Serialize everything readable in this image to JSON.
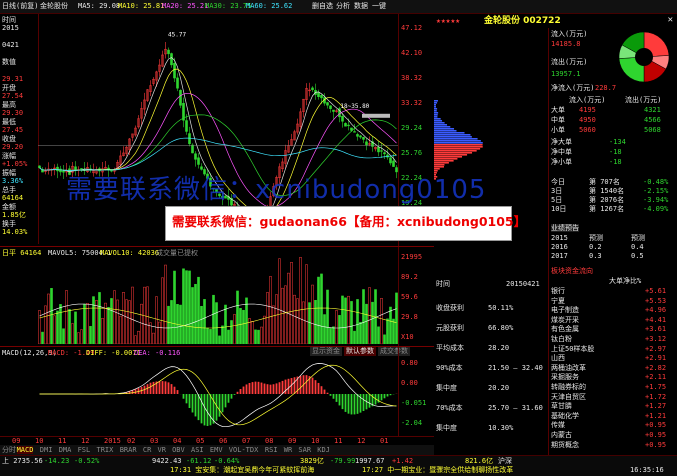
{
  "toolbar": {
    "period": "日线(前复)",
    "stock_name": "金轮股份",
    "ma5": "MA5: 29.08",
    "ma10": "MA10: 25.81",
    "ma20": "MA20: 25.21",
    "ma30": "MA30: 23.75",
    "ma60": "MA60: 25.62",
    "right_tabs": [
      "删自选",
      "分析",
      "数据",
      "一键"
    ]
  },
  "header": {
    "stars": "★★★★★",
    "title": "金轮股份 002722"
  },
  "left_info": [
    {
      "label": "时间",
      "value": "2015",
      "vc": "wht"
    },
    {
      "label": "",
      "value": "0421",
      "vc": "wht"
    },
    {
      "label": "",
      "value": "数值",
      "vc": "wht"
    },
    {
      "label": "",
      "value": "29.31",
      "vc": "red"
    },
    {
      "label": "开盘",
      "value": "27.54",
      "vc": "red"
    },
    {
      "label": "最高",
      "value": "29.30",
      "vc": "red"
    },
    {
      "label": "最低",
      "value": "27.45",
      "vc": "red"
    },
    {
      "label": "收盘",
      "value": "29.20",
      "vc": "red"
    },
    {
      "label": "涨幅",
      "value": "+1.05%",
      "vc": "red"
    },
    {
      "label": "振幅",
      "value": "3.36%",
      "vc": "cyn"
    },
    {
      "label": "总手",
      "value": "64164",
      "vc": "yel"
    },
    {
      "label": "金额",
      "value": "1.85亿",
      "vc": "yel"
    },
    {
      "label": "换手",
      "value": "14.03%",
      "vc": "yel"
    }
  ],
  "price_axis": [
    "47.12",
    "42.10",
    "38.32",
    "33.32",
    "29.24",
    "25.76",
    "22.24",
    "19.24",
    "16.12"
  ],
  "annotations": {
    "high": "45.77",
    "low": "16.12",
    "mid": "18~35.80"
  },
  "watermark_blue": "需要联系微信：xcnibudong0105",
  "banner": "需要联系微信：gudaonan66【备用：xcnibudong0105】",
  "volume": {
    "label": "日平 64164",
    "mavol5": "MAVOL5: 75004.1",
    "mavol10": "MAVOL10: 42036",
    "axis": [
      "21995",
      "89.2",
      "59.6",
      "29.8",
      "X10"
    ],
    "tab_label": "成交量已提权"
  },
  "macd": {
    "label": "MACD(12,26,9)",
    "value": "MACD: -1.49",
    "diff": "DIFF: -0.0071",
    "dea": "DEA: -0.116",
    "axis": [
      "0.80",
      "0.00",
      "-0.051",
      "-2.04"
    ],
    "buttons": [
      "显示资金",
      "默认参数",
      "成交参数"
    ]
  },
  "date_axis": [
    "09",
    "10",
    "11",
    "12",
    "2015",
    "02",
    "03",
    "04",
    "05",
    "06",
    "07",
    "08",
    "09",
    "10",
    "11",
    "12",
    "01"
  ],
  "bottom_tabs": [
    "分时",
    "MACD",
    "DMI",
    "DMA",
    "FSL",
    "TRIX",
    "BRAR",
    "CR",
    "VR",
    "OBV",
    "ASI",
    "EMV",
    "VOL-TDX",
    "RSI",
    "WR",
    "SAR",
    "KDJ"
  ],
  "index_strip": {
    "sh": "上 2735.56",
    "sh_chg": "-14.23",
    "sh_pct": "-0.52%",
    "sz": "9422.43",
    "sz_chg": "-61.12",
    "sz_pct": "-0.64%",
    "c3": "3829亿",
    "c4": "-79.99",
    "c5": "1997.67",
    "c6": "+1.42",
    "c7": "821.6亿",
    "market": "沪深",
    "news1": "17:31 宝安集：潮起宜吴鼎今年可紧蚊挥前海",
    "news2": "17:27 中一期宝业：暨骤宗全供给制聊扬性改革",
    "clock": "16:35:16"
  },
  "right_panel": {
    "inflow_label": "流入(万元)",
    "inflow_value": "14185.8",
    "outflow_label": "流出(万元)",
    "outflow_value": "13957.1",
    "net_label": "净流入(万元)",
    "net_value": "228.7",
    "pie_pcts": [
      "24%",
      "9%",
      "17%",
      "24%",
      "9%",
      "17%"
    ],
    "flow_table_headers": [
      "流入(万元)",
      "流出(万元)"
    ],
    "flow_rows": [
      {
        "label": "大单",
        "in": "4195",
        "out": "4321"
      },
      {
        "label": "中单",
        "in": "4950",
        "out": "4566"
      },
      {
        "label": "小单",
        "in": "5060",
        "out": "5068"
      }
    ],
    "net_rows": [
      {
        "label": "净大单",
        "v": "-134"
      },
      {
        "label": "净中单",
        "v": "-18"
      },
      {
        "label": "净小单",
        "v": "-18"
      }
    ],
    "rank_rows": [
      {
        "label": "今日",
        "rank": "第 707名",
        "pct": "-0.48%"
      },
      {
        "label": "3日",
        "rank": "第 1540名",
        "pct": "-2.15%"
      },
      {
        "label": "5日",
        "rank": "第 2076名",
        "pct": "-3.94%"
      },
      {
        "label": "10日",
        "rank": "第 1267名",
        "pct": "-4.09%"
      }
    ],
    "forecast_title": "业绩预告",
    "forecast_rows": [
      {
        "y": "2015",
        "v": "预测",
        "w": "预测"
      },
      {
        "y": "2016",
        "v": "0.2",
        "w": "0.4"
      },
      {
        "y": "2017",
        "v": "0.3",
        "w": "0.5"
      }
    ],
    "sector_title": "板块资金流向",
    "sector_header": "大单净比%",
    "sectors": [
      {
        "n": "银行",
        "v": "+5.61"
      },
      {
        "n": "宁夏",
        "v": "+5.53"
      },
      {
        "n": "电子制造",
        "v": "+4.96"
      },
      {
        "n": "煤炭开采",
        "v": "+4.41"
      },
      {
        "n": "有色金属",
        "v": "+3.61"
      },
      {
        "n": "钛白粉",
        "v": "+3.12"
      },
      {
        "n": "上证50样本股",
        "v": "+2.97"
      },
      {
        "n": "山西",
        "v": "+2.91"
      },
      {
        "n": "两桶油改革",
        "v": "+2.82"
      },
      {
        "n": "采掘服务",
        "v": "+2.11"
      },
      {
        "n": "转融券标的",
        "v": "+1.75"
      },
      {
        "n": "天津自贸区",
        "v": "+1.72"
      },
      {
        "n": "草甘膦",
        "v": "+1.27"
      },
      {
        "n": "基础化学",
        "v": "+1.21"
      },
      {
        "n": "传媒",
        "v": "+0.95"
      },
      {
        "n": "内蒙古",
        "v": "+0.95"
      },
      {
        "n": "期货概念",
        "v": "+0.95"
      }
    ],
    "chip": {
      "time_label": "时间",
      "time": "20150421",
      "rows": [
        {
          "l": "收盘获利",
          "v": "50.11%"
        },
        {
          "l": "元股获利",
          "v": "66.80%"
        },
        {
          "l": "平均成本",
          "v": "28.20"
        },
        {
          "l": "90%成本",
          "v": "21.50 — 32.40"
        },
        {
          "l": "集中度",
          "v": "20.20"
        },
        {
          "l": "70%成本",
          "v": "25.70 — 31.60"
        },
        {
          "l": "集中度",
          "v": "10.30%"
        }
      ]
    }
  },
  "colors": {
    "bg": "#000000",
    "up": "#ff3b3b",
    "down": "#2fd52f",
    "ma_white": "#e0e0e0",
    "ma_yellow": "#ffff33",
    "ma_magenta": "#ff55ff",
    "ma_green": "#2fd52f",
    "ma_cyan": "#3fe5ff",
    "banner_bg": "#ffffff",
    "banner_text": "#e00000"
  }
}
